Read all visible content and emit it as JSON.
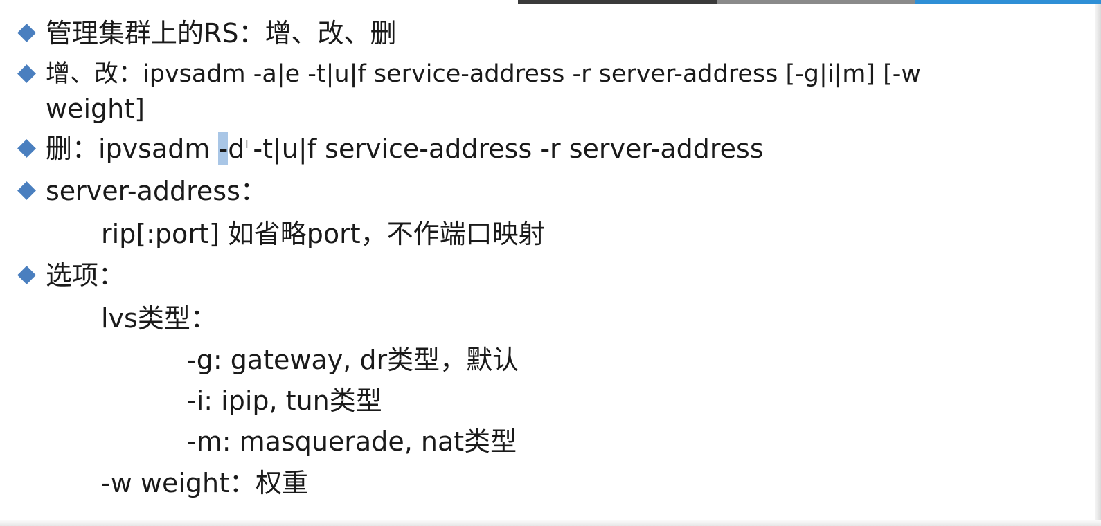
{
  "top_bar": {
    "colors": [
      "#3a3a3a",
      "#8a8a8a",
      "#2e8fd6"
    ]
  },
  "bullet_color": "#4a7fbf",
  "selection_color": "#a9c6e6",
  "slide": {
    "line1": "管理集群上的RS：增、改、删",
    "line2a": "增、改：ipvsadm -a|e -t|u|f service-address -r server-address [-g|i|m] [-w",
    "line2b": "weight]",
    "line3_before": "删：ipvsadm ",
    "line3_selected": "-",
    "line3_after": "d -t|u|f service-address -r server-address",
    "line4": "server-address：",
    "line4_sub": "rip[:port]  如省略port，不作端口映射",
    "line5": "选项：",
    "line5_sub1": "lvs类型：",
    "opt_g": "-g: gateway, dr类型，默认",
    "opt_i": "-i: ipip, tun类型",
    "opt_m": "-m: masquerade, nat类型",
    "opt_w": "-w weight：权重"
  },
  "cursor_icon": "text-cursor-icon"
}
